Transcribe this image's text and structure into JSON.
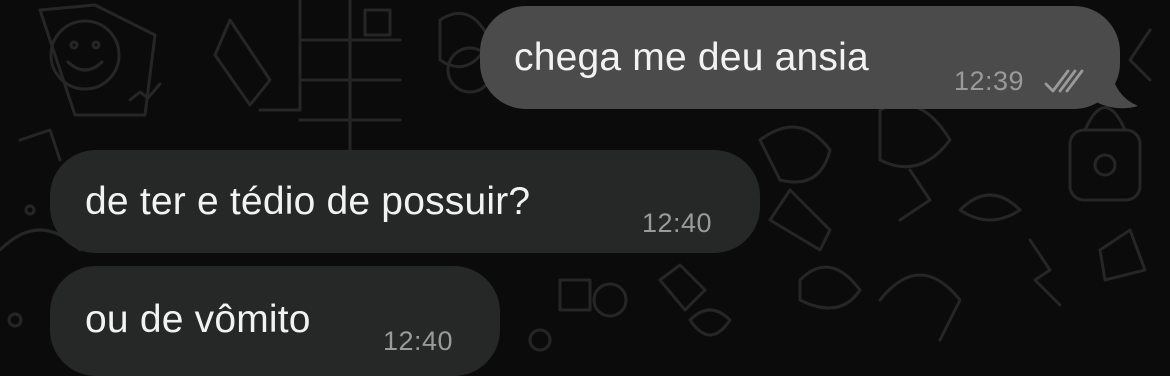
{
  "messages": [
    {
      "direction": "outgoing",
      "text": "chega me deu ansia",
      "time": "12:39",
      "status": "read",
      "status_icon": "double-check-icon"
    },
    {
      "direction": "incoming",
      "text": "de ter e tédio de possuir?",
      "time": "12:40"
    },
    {
      "direction": "incoming",
      "text": "ou de vômito",
      "time": "12:40"
    }
  ],
  "colors": {
    "background": "#0b0b0b",
    "outgoing_bubble": "#4b4b4b",
    "incoming_bubble": "#262727",
    "text": "#f2f2f2",
    "timestamp": "#9a9a9a"
  }
}
